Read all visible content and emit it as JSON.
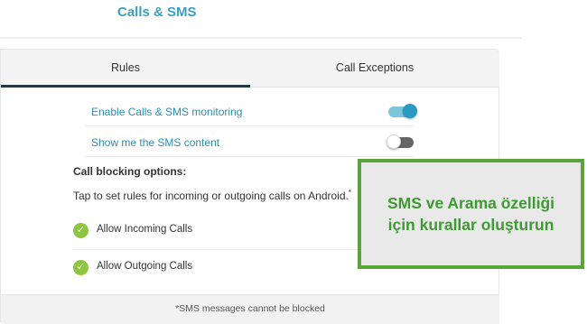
{
  "header": {
    "title": "Calls & SMS"
  },
  "tabs": [
    {
      "label": "Rules",
      "active": true
    },
    {
      "label": "Call Exceptions",
      "active": false
    }
  ],
  "settings": [
    {
      "label": "Enable Calls & SMS monitoring",
      "enabled": true
    },
    {
      "label": "Show me the SMS content",
      "enabled": false
    }
  ],
  "call_blocking": {
    "title": "Call blocking options:",
    "description": "Tap to set rules for incoming or outgoing calls on Android.",
    "description_mark": "*",
    "options": [
      {
        "label": "Allow Incoming Calls",
        "checked": true
      },
      {
        "label": "Allow Outgoing Calls",
        "checked": true
      }
    ]
  },
  "footer": {
    "note": "*SMS messages cannot be blocked"
  },
  "callout": {
    "line1": "SMS ve Arama özelliği",
    "line2": "için kurallar oluşturun"
  },
  "colors": {
    "accent": "#2a98c0",
    "check_green": "#8dc63f",
    "callout_border": "#5aa43b",
    "callout_text": "#3f9a33",
    "tab_indicator": "#243746"
  }
}
